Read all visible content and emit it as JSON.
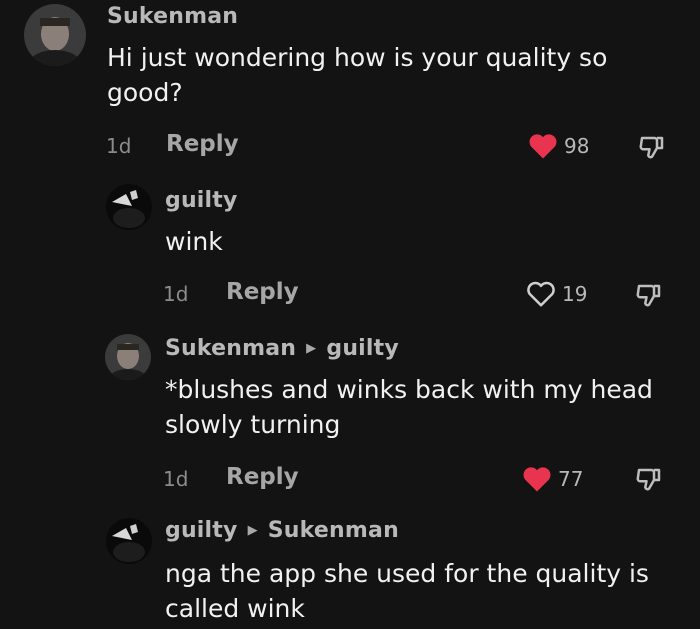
{
  "comments": [
    {
      "author": "Sukenman",
      "reply_to": "",
      "text_lines": [
        "Hi just wondering how is your quality so",
        "good?"
      ],
      "time": "1d",
      "reply_label": "Reply",
      "likes": "98",
      "liked": true,
      "avatar_icon": "user-avatar-photo"
    },
    {
      "author": "guilty",
      "reply_to": "",
      "text_lines": [
        "wink"
      ],
      "time": "1d",
      "reply_label": "Reply",
      "likes": "19",
      "liked": false,
      "avatar_icon": "user-avatar-photo"
    },
    {
      "author": "Sukenman",
      "reply_to": "guilty",
      "text_lines": [
        "*blushes and winks back with my head",
        "slowly turning"
      ],
      "time": "1d",
      "reply_label": "Reply",
      "likes": "77",
      "liked": true,
      "avatar_icon": "user-avatar-photo"
    },
    {
      "author": "guilty",
      "reply_to": "Sukenman",
      "text_lines": [
        "nga the app she used for the quality is",
        "called wink"
      ],
      "time": "",
      "reply_label": "",
      "likes": "",
      "liked": false,
      "avatar_icon": "user-avatar-photo"
    }
  ],
  "colors": {
    "background": "#131313",
    "like_active": "#e8344e",
    "text_primary": "#f1f1f1",
    "text_secondary": "#b9b9b9"
  },
  "icons": {
    "like": "heart-icon",
    "dislike": "thumbs-down-icon",
    "reply_arrow": "triangle-right-icon"
  }
}
